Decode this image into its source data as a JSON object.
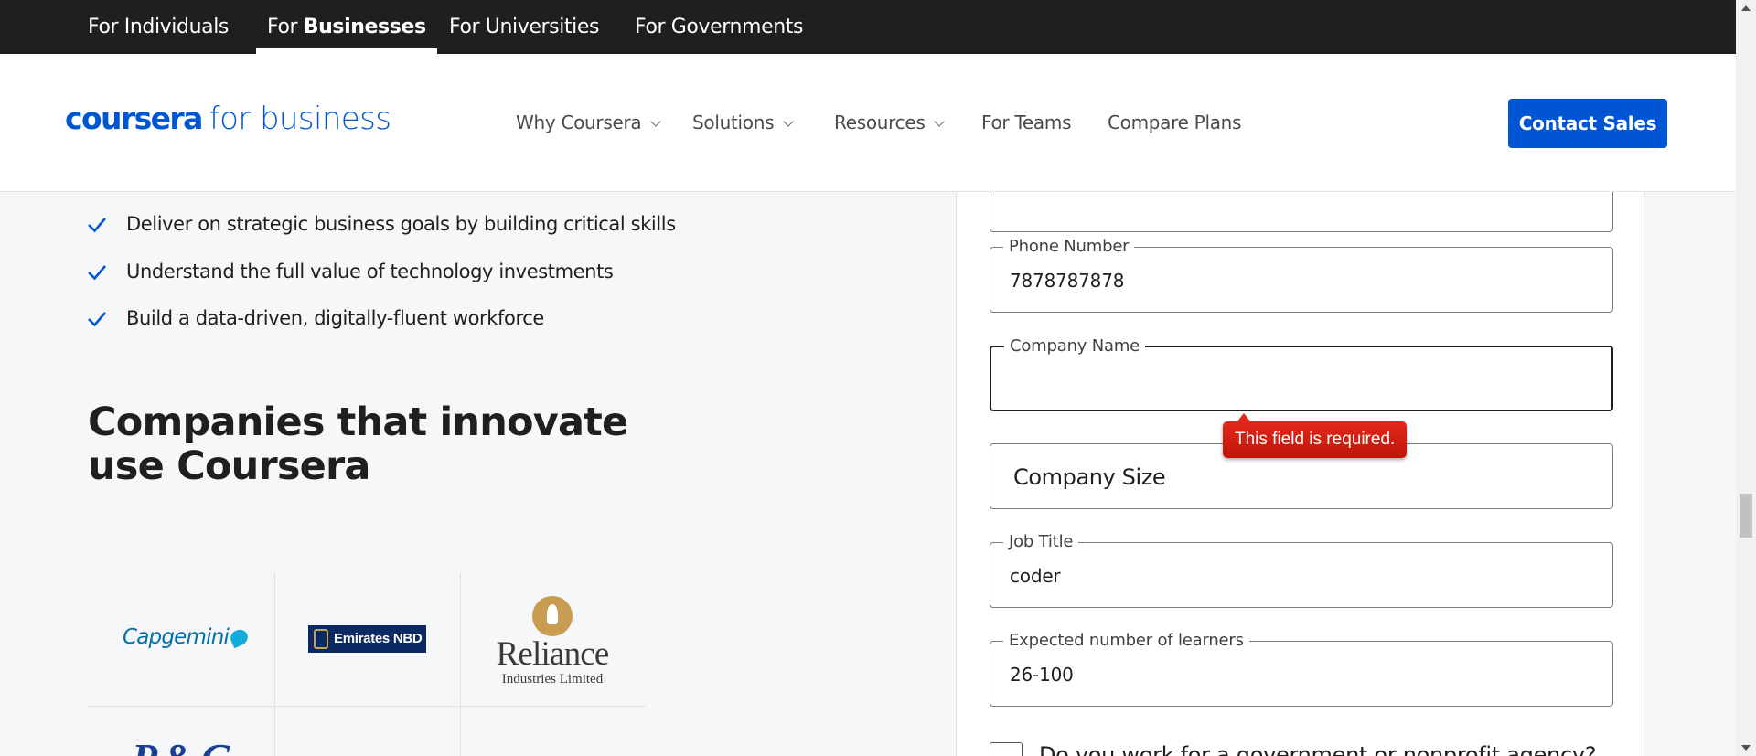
{
  "audience_tabs": [
    {
      "label": "For Individuals"
    },
    {
      "prefix": "For ",
      "bold": "Businesses"
    },
    {
      "label": "For Universities"
    },
    {
      "label": "For Governments"
    }
  ],
  "header": {
    "logo_brand": "coursera",
    "logo_sub": "for business",
    "nav": [
      "Why Coursera",
      "Solutions",
      "Resources",
      "For Teams",
      "Compare Plans"
    ],
    "contact_button": "Contact Sales"
  },
  "benefits": [
    "Deliver on strategic business goals by building critical skills",
    "Understand the full value of technology investments",
    "Build a data-driven, digitally-fluent workforce"
  ],
  "companies_title": "Companies that innovate use Coursera",
  "company_logos": {
    "capgemini": "Capgemini",
    "emirates": "Emirates NBD",
    "reliance_name": "Reliance",
    "reliance_sub": "Industries Limited",
    "pg": "P&G"
  },
  "form": {
    "phone_label": "Phone Number",
    "phone_value": "7878787878",
    "company_name_label": "Company Name",
    "company_name_value": "",
    "company_size_label": "Company Size",
    "job_title_label": "Job Title",
    "job_title_value": "coder",
    "learners_label": "Expected number of learners",
    "learners_value": "26-100",
    "error_message": "This field is required.",
    "gov_checkbox_label": "Do you work for a government or nonprofit agency?"
  },
  "colors": {
    "brand": "#0056d2",
    "topbar": "#1f1f1f",
    "error": "#d21f0f",
    "check": "#0056d2"
  }
}
